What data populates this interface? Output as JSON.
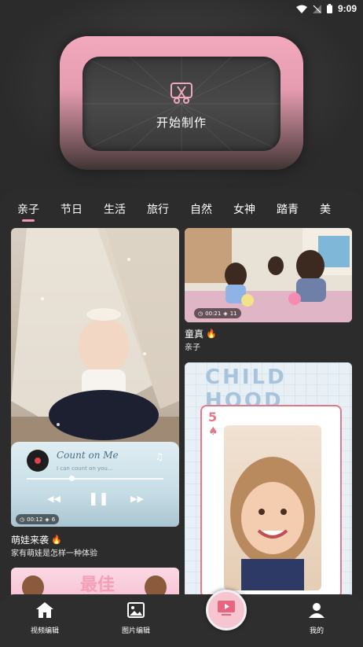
{
  "status_bar": {
    "time": "9:09"
  },
  "hero": {
    "button_label": "开始制作"
  },
  "tabs": [
    "亲子",
    "节日",
    "生活",
    "旅行",
    "自然",
    "女神",
    "踏青",
    "美"
  ],
  "cards": {
    "left_top": {
      "title": "萌娃来袭",
      "subtitle": "家有萌娃是怎样一种体验",
      "duration": "00:12",
      "layers": "6",
      "music_title": "Count on Me",
      "music_lyric": "I can count on you..."
    },
    "right_top": {
      "title": "童真",
      "subtitle": "亲子",
      "duration": "00:21",
      "layers": "11"
    },
    "right_bottom": {
      "banner_text": "CHILD HOOD",
      "card_rank": "5"
    },
    "left_bottom": {
      "banner_text": "最佳"
    }
  },
  "bottom_nav": {
    "video_edit": "视频编辑",
    "photo_edit": "图片编辑",
    "mine": "我的"
  },
  "colors": {
    "accent_pink": "#f29ab2",
    "background": "#2b2a2a"
  }
}
